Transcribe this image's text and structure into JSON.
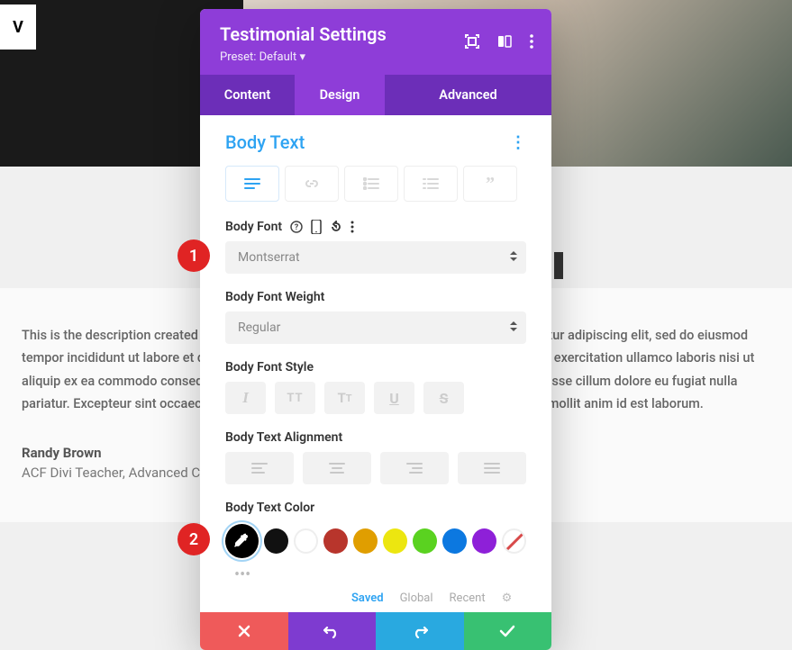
{
  "bg_box_text": "V",
  "description_text": "This is the description created to test custom fields. Lorem ipsum dolor sit amet, consectetur adipiscing elit, sed do eiusmod tempor incididunt ut labore et dolore magna aliqua. Ut enim ad minim veniam, quis nostrud exercitation ullamco laboris nisi ut aliquip ex ea commodo consequat. Duis aute irure dolor in reprehenderit in voluptate velit esse cillum dolore eu fugiat nulla pariatur. Excepteur sint occaecat cupidatat non proident, sunt in culpa qui officia deserunt mollit anim id est laborum.",
  "author": "Randy Brown",
  "author_title": "ACF Divi Teacher, Advanced Custom Fields",
  "panel": {
    "title": "Testimonial Settings",
    "preset": "Preset: Default",
    "tabs": {
      "content": "Content",
      "design": "Design",
      "advanced": "Advanced"
    }
  },
  "section": {
    "title": "Body Text"
  },
  "labels": {
    "body_font": "Body Font",
    "body_font_weight": "Body Font Weight",
    "body_font_style": "Body Font Style",
    "body_text_alignment": "Body Text Alignment",
    "body_text_color": "Body Text Color"
  },
  "values": {
    "body_font": "Montserrat",
    "body_font_weight": "Regular"
  },
  "color_tabs": {
    "saved": "Saved",
    "global": "Global",
    "recent": "Recent"
  },
  "badges": {
    "b1": "1",
    "b2": "2"
  }
}
